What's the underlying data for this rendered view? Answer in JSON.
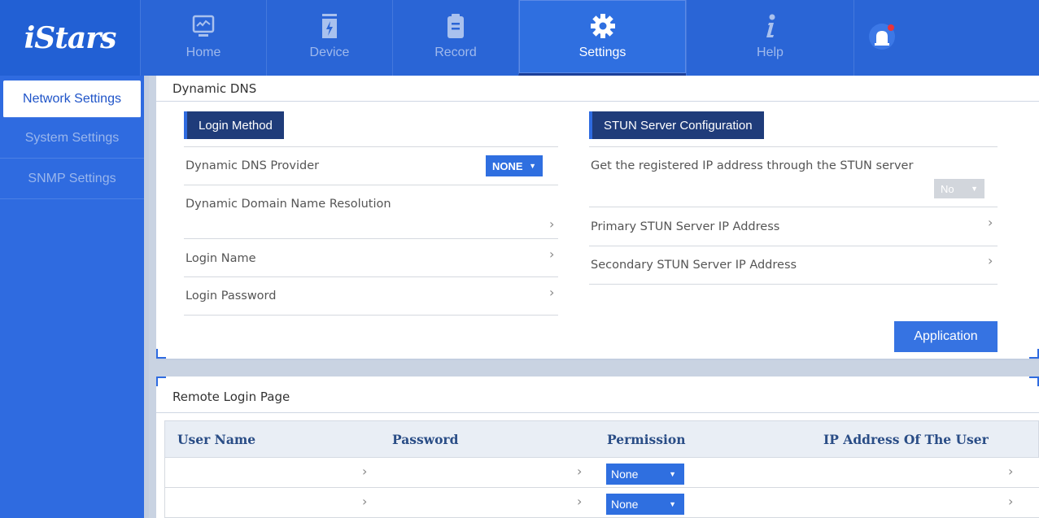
{
  "app": {
    "logo_text": "iStars"
  },
  "nav": {
    "items": [
      {
        "label": "Home",
        "icon": "monitor-chart-icon"
      },
      {
        "label": "Device",
        "icon": "device-battery-icon"
      },
      {
        "label": "Record",
        "icon": "clipboard-icon"
      },
      {
        "label": "Settings",
        "icon": "gear-icon",
        "active": true
      },
      {
        "label": "Help",
        "icon": "info-icon"
      }
    ],
    "alarm_icon": "alarm-bell-icon"
  },
  "sidebar": {
    "items": [
      {
        "label": "Network Settings",
        "active": true
      },
      {
        "label": "System Settings"
      },
      {
        "label": "SNMP Settings"
      }
    ]
  },
  "ddns": {
    "title": "Dynamic DNS",
    "login_method_label": "Login Method",
    "provider_label": "Dynamic DNS Provider",
    "provider_value": "NONE",
    "resolution_label": "Dynamic Domain Name Resolution",
    "login_name_label": "Login Name",
    "login_password_label": "Login Password",
    "stun_label": "STUN Server Configuration",
    "stun_get_label": "Get the registered IP address through the STUN server",
    "stun_get_value": "No",
    "primary_label": "Primary STUN Server IP Address",
    "secondary_label": "Secondary STUN Server IP Address",
    "apply_label": "Application"
  },
  "remote": {
    "title": "Remote Login Page",
    "columns": [
      "User Name",
      "Password",
      "Permission",
      "IP Address Of The User"
    ],
    "rows": [
      {
        "permission": "None"
      },
      {
        "permission": "None"
      }
    ]
  },
  "colors": {
    "primary": "#2a65d6",
    "dark_label": "#1f3c7a",
    "accent_red": "#e8333a"
  }
}
